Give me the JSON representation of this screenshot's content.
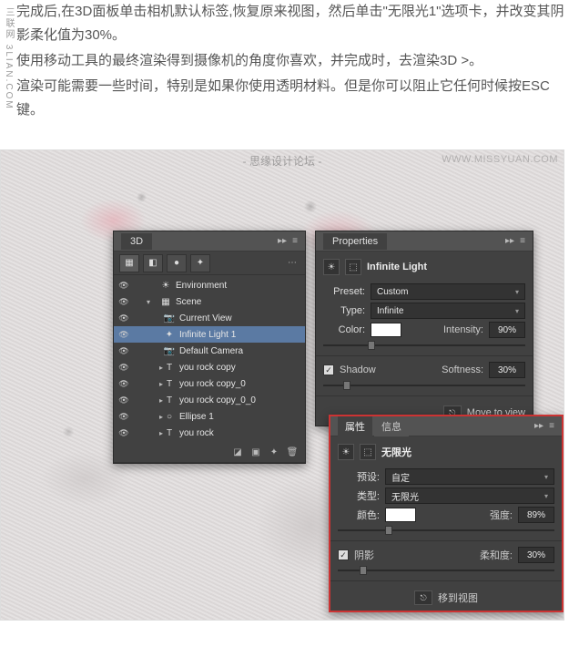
{
  "watermarks": {
    "left": "三联网 3LIAN.COM",
    "center": "- 思缘设计论坛 -",
    "right": "WWW.MISSYUAN.COM"
  },
  "article": {
    "p1": "完成后,在3D面板单击相机默认标签,恢复原来视图，然后单击\"无限光1\"选项卡，并改变其阴影柔化值为30%。",
    "p2": "使用移动工具的最终渲染得到摄像机的角度你喜欢，并完成时，去渲染3D >。",
    "p3": "渲染可能需要一些时间，特别是如果你使用透明材料。但是你可以阻止它任何时候按ESC键。"
  },
  "panel3d": {
    "title": "3D",
    "rows": [
      {
        "icon": "☀",
        "label": "Environment",
        "indent": 0,
        "twist": ""
      },
      {
        "icon": "▦",
        "label": "Scene",
        "indent": 0,
        "twist": "▾"
      },
      {
        "icon": "📷",
        "label": "Current View",
        "indent": 1,
        "twist": ""
      },
      {
        "icon": "✦",
        "label": "Infinite Light 1",
        "indent": 1,
        "twist": "",
        "sel": true
      },
      {
        "icon": "📷",
        "label": "Default Camera",
        "indent": 1,
        "twist": ""
      },
      {
        "icon": "T",
        "label": "you rock copy",
        "indent": 1,
        "twist": "▸"
      },
      {
        "icon": "T",
        "label": "you rock copy_0",
        "indent": 1,
        "twist": "▸"
      },
      {
        "icon": "T",
        "label": "you rock copy_0_0",
        "indent": 1,
        "twist": "▸"
      },
      {
        "icon": "○",
        "label": "Ellipse 1",
        "indent": 1,
        "twist": "▸"
      },
      {
        "icon": "T",
        "label": "you rock",
        "indent": 1,
        "twist": "▸"
      }
    ]
  },
  "props": {
    "title": "Properties",
    "heading": "Infinite Light",
    "preset": {
      "label": "Preset:",
      "value": "Custom"
    },
    "type": {
      "label": "Type:",
      "value": "Infinite"
    },
    "color": {
      "label": "Color:"
    },
    "intensity": {
      "label": "Intensity:",
      "value": "90%"
    },
    "shadow": {
      "label": "Shadow"
    },
    "softness": {
      "label": "Softness:",
      "value": "30%"
    },
    "move": "Move to view"
  },
  "propsCn": {
    "tabs": [
      "属性",
      "信息"
    ],
    "heading": "无限光",
    "preset": {
      "label": "预设:",
      "value": "自定"
    },
    "type": {
      "label": "类型:",
      "value": "无限光"
    },
    "color": {
      "label": "颜色:"
    },
    "intensity": {
      "label": "强度:",
      "value": "89%"
    },
    "shadow": {
      "label": "阴影"
    },
    "softness": {
      "label": "柔和度:",
      "value": "30%"
    },
    "move": "移到视图"
  }
}
